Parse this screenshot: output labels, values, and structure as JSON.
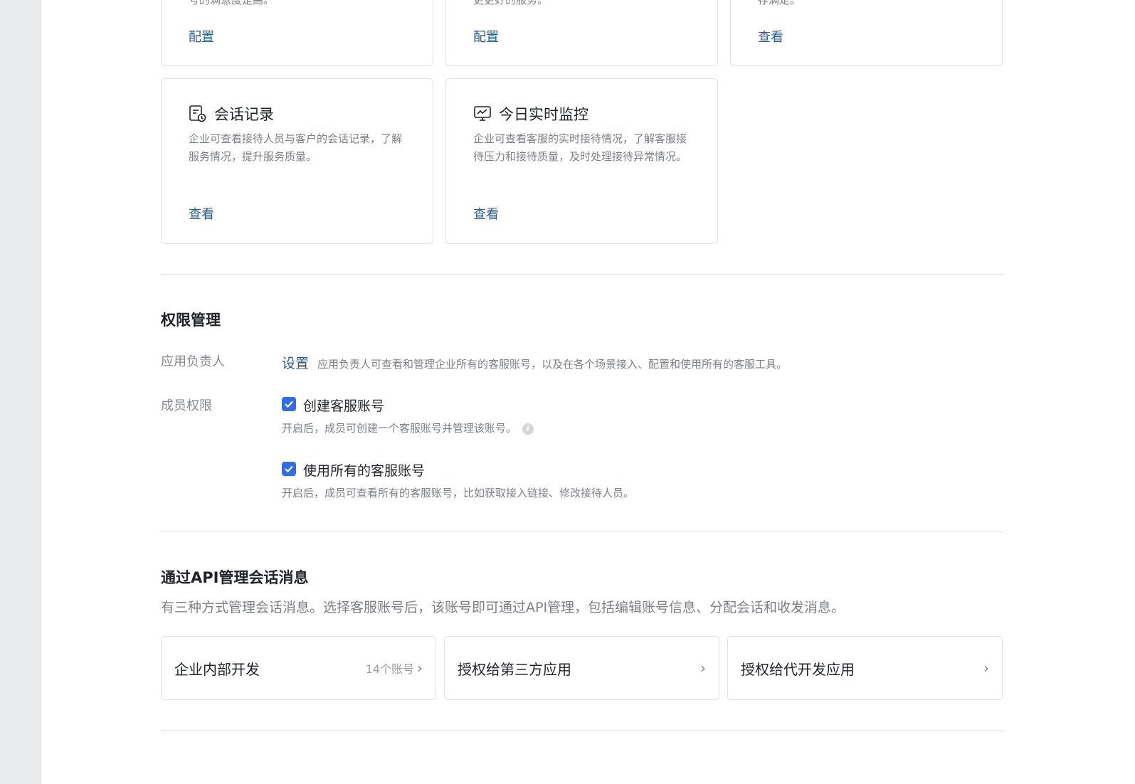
{
  "top_cards": [
    {
      "desc_tail": "号的满意度是高。",
      "link": "配置"
    },
    {
      "desc_tail": "更更好的服务。",
      "link": "配置"
    },
    {
      "desc_tail": "存满足。",
      "link": "查看"
    }
  ],
  "feature_cards": [
    {
      "icon": "document-clock-icon",
      "title": "会话记录",
      "desc": "企业可查看接待人员与客户的会话记录，了解服务情况，提升服务质量。",
      "link": "查看"
    },
    {
      "icon": "monitor-chart-icon",
      "title": "今日实时监控",
      "desc": "企业可查看客服的实时接待情况，了解客服接待压力和接待质量，及时处理接待异常情况。",
      "link": "查看"
    }
  ],
  "permissions": {
    "title": "权限管理",
    "owner_label": "应用负责人",
    "owner_link": "设置",
    "owner_desc": "应用负责人可查看和管理企业所有的客服账号，以及在各个场景接入、配置和使用所有的客服工具。",
    "member_label": "成员权限",
    "options": [
      {
        "label": "创建客服账号",
        "checked": true,
        "hint": "开启后，成员可创建一个客服账号并管理该账号。"
      },
      {
        "label": "使用所有的客服账号",
        "checked": true,
        "hint": "开启后，成员可查看所有的客服账号，比如获取接入链接、修改接待人员。"
      }
    ]
  },
  "api": {
    "title": "通过API管理会话消息",
    "desc": "有三种方式管理会话消息。选择客服账号后，该账号即可通过API管理，包括编辑账号信息、分配会话和收发消息。",
    "cards": [
      {
        "label": "企业内部开发",
        "meta": "14个账号"
      },
      {
        "label": "授权给第三方应用",
        "meta": ""
      },
      {
        "label": "授权给代开发应用",
        "meta": ""
      }
    ]
  },
  "colors": {
    "accent": "#2f6ee6",
    "link": "#2a5a9b"
  }
}
